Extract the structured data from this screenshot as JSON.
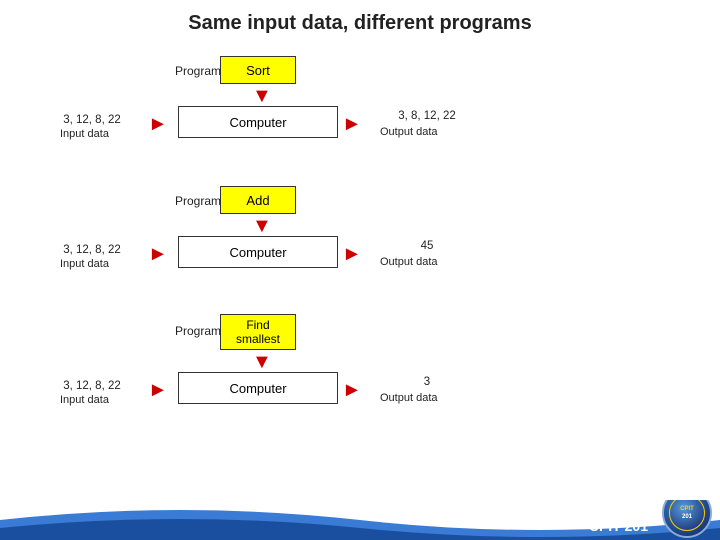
{
  "title": "Same input data, different programs",
  "blocks": [
    {
      "id": "block1",
      "program_label": "Program",
      "program_name": "Sort",
      "input_values": "3, 12, 8, 22",
      "input_label": "Input data",
      "computer_label": "Computer",
      "output_values": "3, 8, 12, 22",
      "output_label": "Output data"
    },
    {
      "id": "block2",
      "program_label": "Program",
      "program_name": "Add",
      "input_values": "3, 12, 8, 22",
      "input_label": "Input data",
      "computer_label": "Computer",
      "output_values": "45",
      "output_label": "Output data"
    },
    {
      "id": "block3",
      "program_label": "Program",
      "program_name": "Find\nsmallest",
      "input_values": "3, 12, 8, 22",
      "input_label": "Input data",
      "computer_label": "Computer",
      "output_values": "3",
      "output_label": "Output data"
    }
  ],
  "footer": {
    "text": "CPIT 201",
    "logo_line1": "CPIT",
    "logo_line2": "201"
  },
  "icons": {
    "arrow_down": "▼",
    "arrow_right": "►"
  }
}
